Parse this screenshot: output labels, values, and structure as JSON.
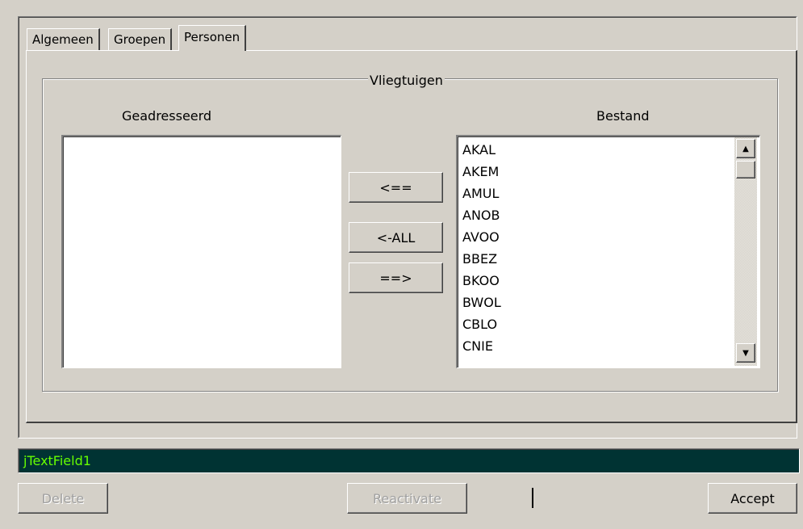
{
  "tabs": [
    {
      "label": "Algemeen",
      "active": false
    },
    {
      "label": "Groepen",
      "active": false
    },
    {
      "label": "Personen",
      "active": true
    }
  ],
  "group": {
    "title": "Vliegtuigen",
    "left_label": "Geadresseerd",
    "right_label": "Bestand",
    "addressed_items": [],
    "available_items": [
      "AKAL",
      "AKEM",
      "AMUL",
      "ANOB",
      "AVOO",
      "BBEZ",
      "BKOO",
      "BWOL",
      "CBLO",
      "CNIE"
    ]
  },
  "transfer_buttons": {
    "add_label": "<==",
    "add_all_label": "<-ALL",
    "remove_label": "==>"
  },
  "text_field": {
    "value": "jTextField1",
    "bg_color": "#003333",
    "text_color": "#66ff00"
  },
  "footer": {
    "delete_label": "Delete",
    "reactivate_label": "Reactivate",
    "accept_label": "Accept"
  }
}
